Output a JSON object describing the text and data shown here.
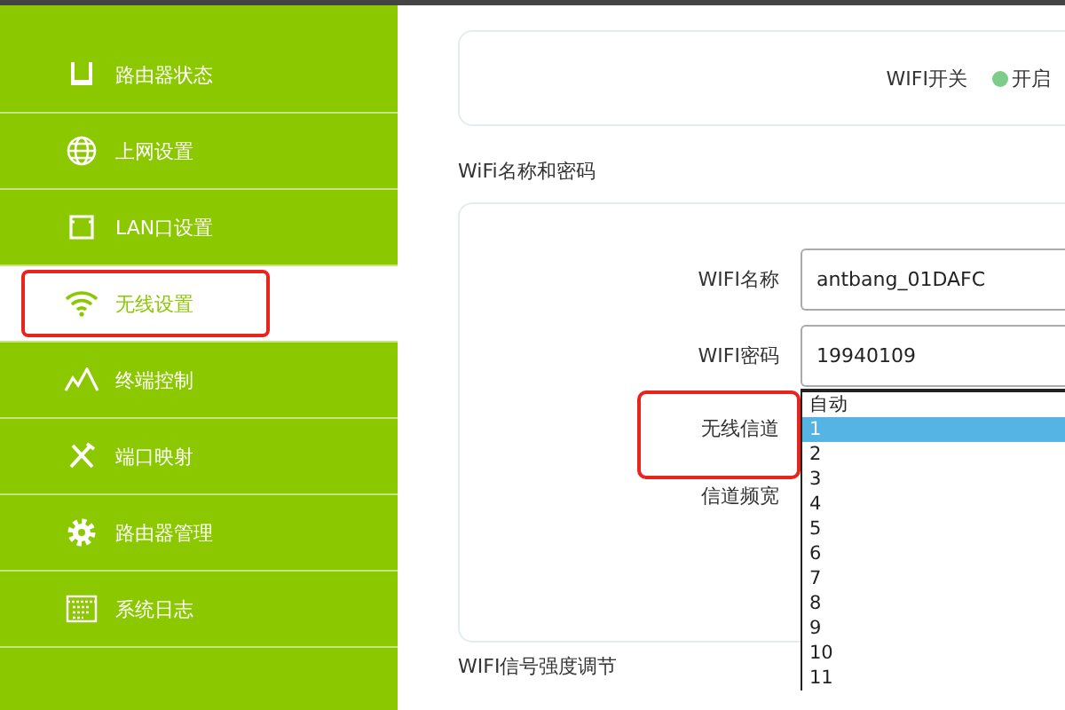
{
  "sidebar": {
    "items": [
      {
        "label": "路由器状态",
        "selected": false,
        "highlighted": false
      },
      {
        "label": "上网设置",
        "selected": false,
        "highlighted": false
      },
      {
        "label": "LAN口设置",
        "selected": false,
        "highlighted": false
      },
      {
        "label": "无线设置",
        "selected": true,
        "highlighted": true
      },
      {
        "label": "终端控制",
        "selected": false,
        "highlighted": false
      },
      {
        "label": "端口映射",
        "selected": false,
        "highlighted": false
      },
      {
        "label": "路由器管理",
        "selected": false,
        "highlighted": false
      },
      {
        "label": "系统日志",
        "selected": false,
        "highlighted": false
      }
    ]
  },
  "wifi_switch": {
    "label": "WIFI开关",
    "status": "开启",
    "on": true
  },
  "section_title": "WiFi名称和密码",
  "fields": [
    {
      "label": "WIFI名称",
      "kind": "input",
      "value": "antbang_01DAFC",
      "highlighted": false
    },
    {
      "label": "WIFI密码",
      "kind": "input",
      "value": "19940109",
      "highlighted": false
    },
    {
      "label": "无线信道",
      "kind": "dropdown",
      "highlighted": true,
      "options": [
        {
          "label": "自动",
          "selected": false
        },
        {
          "label": "1",
          "selected": true
        },
        {
          "label": "2",
          "selected": false
        },
        {
          "label": "3",
          "selected": false
        },
        {
          "label": "4",
          "selected": false
        },
        {
          "label": "5",
          "selected": false
        },
        {
          "label": "6",
          "selected": false
        },
        {
          "label": "7",
          "selected": false
        },
        {
          "label": "8",
          "selected": false
        },
        {
          "label": "9",
          "selected": false
        },
        {
          "label": "10",
          "selected": false
        },
        {
          "label": "11",
          "selected": false
        }
      ]
    },
    {
      "label": "信道频宽",
      "kind": "label",
      "highlighted": false
    }
  ],
  "bottom_section_title": "WIFI信号强度调节"
}
